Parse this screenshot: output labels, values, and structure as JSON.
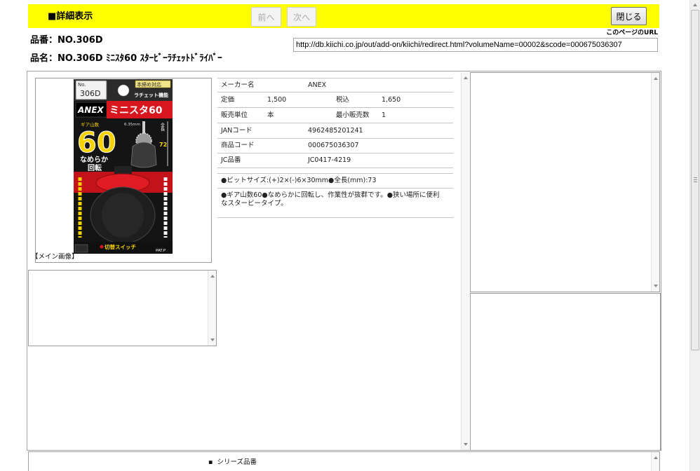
{
  "theme": {
    "header_bg": "#FFFF00",
    "package_red": "#D7161E"
  },
  "header": {
    "title": "■詳細表示",
    "prev_label": "前へ",
    "next_label": "次へ",
    "close_label": "閉じる"
  },
  "product": {
    "code_label": "品番：",
    "code": "NO.306D",
    "name_label": "品名：",
    "name": "NO.306D ﾐﾆｽﾀ60 ｽﾀｰﾋﾞｰﾗﾁｪｯﾄﾄﾞﾗｲﾊﾞｰ"
  },
  "page_url": {
    "label": "このページのURL",
    "value": "http://db.kiichi.co.jp/out/add-on/kiichi/redirect.html?volumeName=00002&scode=000675036307"
  },
  "main_image": {
    "caption": "【メイン画像】",
    "package_text": {
      "no": "No.",
      "model": "306D",
      "badge": "本締め対応",
      "feature": "ラチェット機能",
      "brand": "ANEX",
      "series": "ミニスタ60",
      "gear_label": "ギア山数",
      "gear_count": "60",
      "smooth_1": "なめらか",
      "smooth_2": "回転",
      "bit": "6.35mm",
      "length_label": "全長",
      "length": "72",
      "switch": "切替スイッチ",
      "patent": "PAT.P"
    }
  },
  "details": {
    "maker_label": "メーカー名",
    "maker": "ANEX",
    "list_price_label": "定価",
    "list_price": "1,500",
    "tax_incl_label": "税込",
    "tax_incl": "1,650",
    "unit_label": "販売単位",
    "unit": "本",
    "min_qty_label": "最小販売数",
    "min_qty": "1",
    "jan_label": "JANコード",
    "jan": "4962485201241",
    "product_code_label": "商品コード",
    "product_code": "000675036307",
    "jc_label": "JC品番",
    "jc": "JC0417-4219",
    "spec": "●ビットサイズ:(+)2×(-)6×30mm●全長(mm):73",
    "description": "●ギア山数60●なめらかに回転し、作業性が抜群です。●狭い場所に便利なスタービータイプ。"
  },
  "series": {
    "bullet": "▪",
    "label": "シリーズ品番"
  }
}
